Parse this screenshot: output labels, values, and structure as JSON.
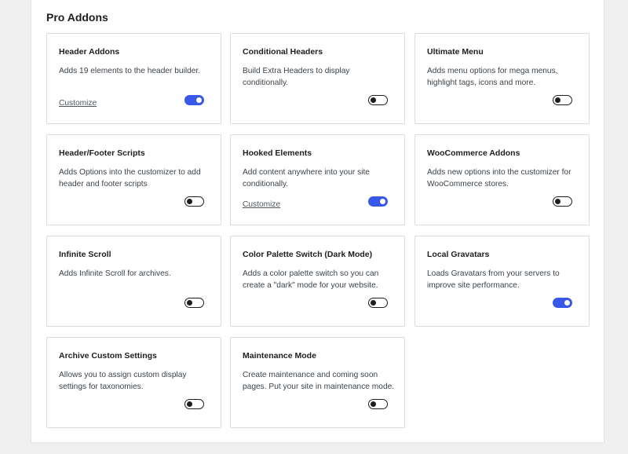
{
  "section": {
    "title": "Pro Addons"
  },
  "addons": [
    {
      "title": "Header Addons",
      "desc": "Adds 19 elements to the header builder.",
      "link": "Customize",
      "enabled": true
    },
    {
      "title": "Conditional Headers",
      "desc": "Build Extra Headers to display conditionally.",
      "link": "",
      "enabled": false
    },
    {
      "title": "Ultimate Menu",
      "desc": "Adds menu options for mega menus, highlight tags, icons and more.",
      "link": "",
      "enabled": false
    },
    {
      "title": "Header/Footer Scripts",
      "desc": "Adds Options into the customizer to add header and footer scripts",
      "link": "",
      "enabled": false
    },
    {
      "title": "Hooked Elements",
      "desc": "Add content anywhere into your site conditionally.",
      "link": "Customize",
      "enabled": true
    },
    {
      "title": "WooCommerce Addons",
      "desc": "Adds new options into the customizer for WooCommerce stores.",
      "link": "",
      "enabled": false
    },
    {
      "title": "Infinite Scroll",
      "desc": "Adds Infinite Scroll for archives.",
      "link": "",
      "enabled": false
    },
    {
      "title": "Color Palette Switch (Dark Mode)",
      "desc": "Adds a color palette switch so you can create a \"dark\" mode for your website.",
      "link": "",
      "enabled": false
    },
    {
      "title": "Local Gravatars",
      "desc": "Loads Gravatars from your servers to improve site performance.",
      "link": "",
      "enabled": true
    },
    {
      "title": "Archive Custom Settings",
      "desc": "Allows you to assign custom display settings for taxonomies.",
      "link": "",
      "enabled": false
    },
    {
      "title": "Maintenance Mode",
      "desc": "Create maintenance and coming soon pages. Put your site in maintenance mode.",
      "link": "",
      "enabled": false
    }
  ],
  "colors": {
    "accent": "#3858e9"
  }
}
